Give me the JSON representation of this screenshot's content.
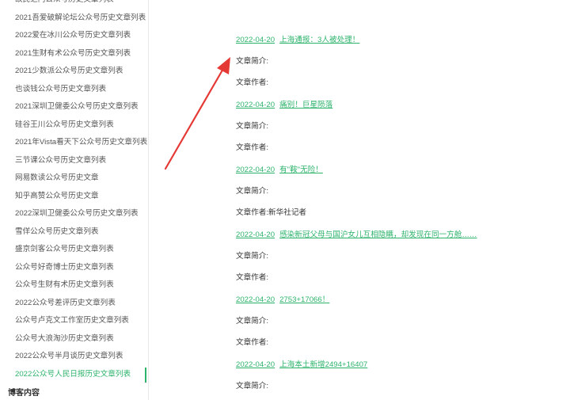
{
  "sidebar": {
    "items": [
      "故民之门公众号历史文章列表",
      "2021吾爱破解论坛公众号历史文章列表",
      "2022爱在冰川公众号历史文章列表",
      "2021生财有术公众号历史文章列表",
      "2021少数派公众号历史文章列表",
      "也谈钱公众号历史文章列表",
      "2021深圳卫健委公众号历史文章列表",
      "硅谷王川公众号历史文章列表",
      "2021年Vista看天下公众号历史文章列表",
      "三节课公众号历史文章列表",
      "网易数读公众号历史文章",
      "知乎高赞公众号历史文章",
      "2022深圳卫健委公众号历史文章列表",
      "雪佯公众号历史文章列表",
      "盛京剑客公众号历史文章列表",
      "公众号好奇博士历史文章列表",
      "公众号生财有术历史文章列表",
      "2022公众号差评历史文章列表",
      "公众号卢克文工作室历史文章列表",
      "公众号大浪淘沙历史文章列表",
      "2022公众号半月谈历史文章列表",
      "2022公众号人民日报历史文章列表"
    ],
    "active_index": 21,
    "section_title": "博客内容"
  },
  "articles": [
    {
      "date": "2022-04-20",
      "title": "上海通报：3人被处理！",
      "summary_label": "文章简介:",
      "summary": "",
      "author_label": "文章作者:",
      "author": ""
    },
    {
      "date": "2022-04-20",
      "title": "痛别！巨星陨落",
      "summary_label": "文章简介:",
      "summary": "",
      "author_label": "文章作者:",
      "author": ""
    },
    {
      "date": "2022-04-20",
      "title": "有\"鞍\"无险！",
      "summary_label": "文章简介:",
      "summary": "",
      "author_label": "文章作者:",
      "author": "新华社记者"
    },
    {
      "date": "2022-04-20",
      "title": "感染新冠父母与国沪女儿互相隐瞒，却发现在同一方舱……",
      "summary_label": "文章简介:",
      "summary": "",
      "author_label": "文章作者:",
      "author": ""
    },
    {
      "date": "2022-04-20",
      "title": "2753+17066！",
      "summary_label": "文章简介:",
      "summary": "",
      "author_label": "文章作者:",
      "author": ""
    },
    {
      "date": "2022-04-20",
      "title": "上海本土新增2494+16407",
      "summary_label": "文章简介:",
      "summary": ""
    }
  ],
  "colors": {
    "accent": "#2eb36c",
    "arrow": "#e53935"
  }
}
